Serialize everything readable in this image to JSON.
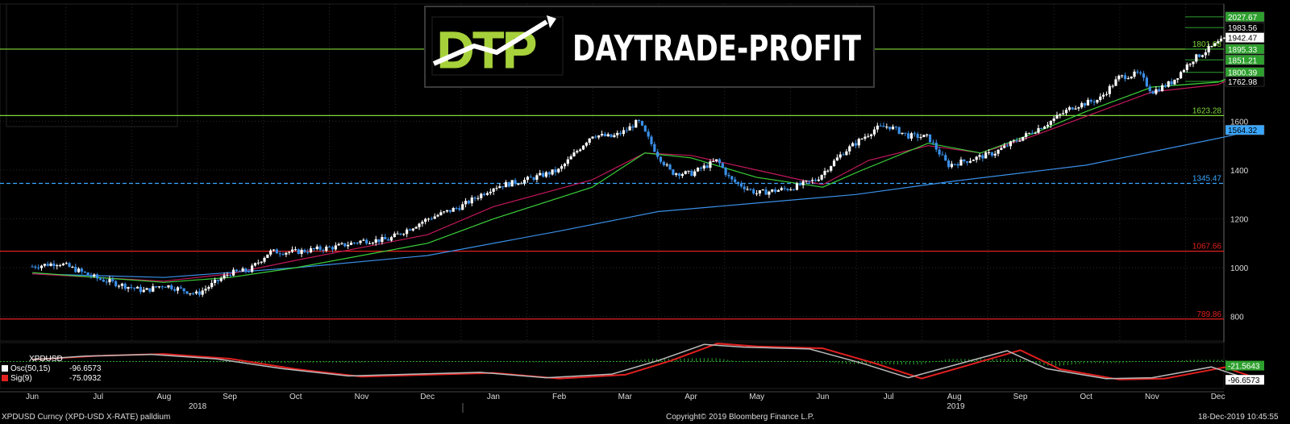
{
  "logo": {
    "mark": "DTP",
    "text": "DAYTRADE-PROFIT"
  },
  "chart_data": {
    "type": "candlestick",
    "y_ticks": [
      "1600",
      "1400",
      "1200",
      "1000",
      "800"
    ],
    "ylim": [
      700,
      2080
    ],
    "x_months": [
      "Jun",
      "Jul",
      "Aug",
      "Sep",
      "Oct",
      "Nov",
      "Dec",
      "Jan",
      "Feb",
      "Mar",
      "Apr",
      "May",
      "Jun",
      "Jul",
      "Aug",
      "Sep",
      "Oct",
      "Nov",
      "Dec"
    ],
    "x_years": [
      "2018",
      "2019"
    ],
    "price_path": [
      {
        "m": 0.0,
        "v": 1005
      },
      {
        "m": 0.4,
        "v": 1020
      },
      {
        "m": 1.0,
        "v": 955
      },
      {
        "m": 1.7,
        "v": 905
      },
      {
        "m": 2.0,
        "v": 930
      },
      {
        "m": 2.5,
        "v": 892
      },
      {
        "m": 3.0,
        "v": 978
      },
      {
        "m": 3.3,
        "v": 990
      },
      {
        "m": 3.6,
        "v": 1065
      },
      {
        "m": 4.0,
        "v": 1065
      },
      {
        "m": 4.6,
        "v": 1085
      },
      {
        "m": 5.0,
        "v": 1110
      },
      {
        "m": 5.4,
        "v": 1115
      },
      {
        "m": 6.0,
        "v": 1200
      },
      {
        "m": 6.5,
        "v": 1250
      },
      {
        "m": 7.0,
        "v": 1330
      },
      {
        "m": 7.5,
        "v": 1360
      },
      {
        "m": 8.0,
        "v": 1400
      },
      {
        "m": 8.5,
        "v": 1545
      },
      {
        "m": 8.8,
        "v": 1535
      },
      {
        "m": 9.0,
        "v": 1560
      },
      {
        "m": 9.2,
        "v": 1600
      },
      {
        "m": 9.5,
        "v": 1460
      },
      {
        "m": 9.7,
        "v": 1390
      },
      {
        "m": 10.0,
        "v": 1385
      },
      {
        "m": 10.4,
        "v": 1440
      },
      {
        "m": 10.6,
        "v": 1360
      },
      {
        "m": 11.0,
        "v": 1305
      },
      {
        "m": 11.5,
        "v": 1325
      },
      {
        "m": 11.9,
        "v": 1360
      },
      {
        "m": 12.3,
        "v": 1470
      },
      {
        "m": 12.8,
        "v": 1570
      },
      {
        "m": 13.0,
        "v": 1580
      },
      {
        "m": 13.3,
        "v": 1540
      },
      {
        "m": 13.6,
        "v": 1535
      },
      {
        "m": 13.9,
        "v": 1420
      },
      {
        "m": 14.2,
        "v": 1440
      },
      {
        "m": 14.6,
        "v": 1470
      },
      {
        "m": 15.0,
        "v": 1530
      },
      {
        "m": 15.4,
        "v": 1590
      },
      {
        "m": 15.8,
        "v": 1660
      },
      {
        "m": 16.2,
        "v": 1690
      },
      {
        "m": 16.5,
        "v": 1780
      },
      {
        "m": 16.8,
        "v": 1795
      },
      {
        "m": 17.0,
        "v": 1720
      },
      {
        "m": 17.3,
        "v": 1760
      },
      {
        "m": 17.6,
        "v": 1850
      },
      {
        "m": 18.0,
        "v": 1920
      },
      {
        "m": 18.3,
        "v": 1965
      }
    ],
    "ma_slow": [
      {
        "m": 0,
        "v": 975
      },
      {
        "m": 2,
        "v": 960
      },
      {
        "m": 4,
        "v": 1000
      },
      {
        "m": 6,
        "v": 1050
      },
      {
        "m": 8,
        "v": 1150
      },
      {
        "m": 9.5,
        "v": 1230
      },
      {
        "m": 11,
        "v": 1265
      },
      {
        "m": 12.5,
        "v": 1300
      },
      {
        "m": 14,
        "v": 1355
      },
      {
        "m": 16,
        "v": 1420
      },
      {
        "m": 18,
        "v": 1530
      },
      {
        "m": 18.6,
        "v": 1564
      }
    ],
    "ma_mid": [
      {
        "m": 0,
        "v": 975
      },
      {
        "m": 2,
        "v": 945
      },
      {
        "m": 3,
        "v": 975
      },
      {
        "m": 4,
        "v": 1030
      },
      {
        "m": 6,
        "v": 1135
      },
      {
        "m": 7,
        "v": 1250
      },
      {
        "m": 8.5,
        "v": 1360
      },
      {
        "m": 9.3,
        "v": 1470
      },
      {
        "m": 10,
        "v": 1460
      },
      {
        "m": 11,
        "v": 1400
      },
      {
        "m": 12,
        "v": 1340
      },
      {
        "m": 12.7,
        "v": 1440
      },
      {
        "m": 13.6,
        "v": 1500
      },
      {
        "m": 14.4,
        "v": 1470
      },
      {
        "m": 15.2,
        "v": 1540
      },
      {
        "m": 16,
        "v": 1620
      },
      {
        "m": 17,
        "v": 1720
      },
      {
        "m": 18,
        "v": 1750
      },
      {
        "m": 18.4,
        "v": 1800
      }
    ],
    "ma_fast": [
      {
        "m": 0,
        "v": 980
      },
      {
        "m": 2,
        "v": 940
      },
      {
        "m": 3,
        "v": 960
      },
      {
        "m": 4,
        "v": 1000
      },
      {
        "m": 6,
        "v": 1100
      },
      {
        "m": 7,
        "v": 1200
      },
      {
        "m": 8.5,
        "v": 1330
      },
      {
        "m": 9.3,
        "v": 1470
      },
      {
        "m": 10,
        "v": 1450
      },
      {
        "m": 11,
        "v": 1370
      },
      {
        "m": 12,
        "v": 1330
      },
      {
        "m": 12.6,
        "v": 1400
      },
      {
        "m": 13.6,
        "v": 1510
      },
      {
        "m": 14.4,
        "v": 1470
      },
      {
        "m": 15.2,
        "v": 1550
      },
      {
        "m": 16,
        "v": 1640
      },
      {
        "m": 17,
        "v": 1740
      },
      {
        "m": 18,
        "v": 1760
      },
      {
        "m": 18.4,
        "v": 1800
      }
    ],
    "levels": [
      {
        "value": 1895.33,
        "label": "1801.08",
        "color": "#7fd93a",
        "style": "solid"
      },
      {
        "value": 1623.28,
        "label": "1623.28",
        "color": "#7fd93a",
        "style": "solid"
      },
      {
        "value": 1345.47,
        "label": "1345.47",
        "color": "#3aa7ff",
        "style": "dashed"
      },
      {
        "value": 1067.66,
        "label": "1067.66",
        "color": "#e22020",
        "style": "solid"
      },
      {
        "value": 789.86,
        "label": "789.86",
        "color": "#e22020",
        "style": "solid"
      }
    ],
    "right_labels": [
      {
        "value": 2027.67,
        "text": "2027.67",
        "bg": "#2ea02e",
        "fg": "#fff"
      },
      {
        "value": 1983.56,
        "text": "1983.56",
        "bg": "#000",
        "fg": "#fff"
      },
      {
        "value": 1942.47,
        "text": "1942.47",
        "bg": "#fff",
        "fg": "#000"
      },
      {
        "value": 1895.33,
        "text": "1895.33",
        "bg": "#2ea02e",
        "fg": "#fff"
      },
      {
        "value": 1851.21,
        "text": "1851.21",
        "bg": "#2ea02e",
        "fg": "#fff"
      },
      {
        "value": 1800.39,
        "text": "1800.39",
        "bg": "#2ea02e",
        "fg": "#fff"
      },
      {
        "value": 1762.98,
        "text": "1762.98",
        "bg": "#000",
        "fg": "#fff"
      },
      {
        "value": 1564.32,
        "text": "1564.32",
        "bg": "#3aa7ff",
        "fg": "#000"
      }
    ],
    "oscillator": {
      "title": "XPDUSD",
      "osc_label": "Osc(50,15)",
      "osc_value": "-96.6573",
      "sig_label": "Sig(9)",
      "sig_value": "-75.0932",
      "right_top": "-21.5643",
      "right_bottom": "-96.6573",
      "path": [
        {
          "m": 0,
          "v": 10
        },
        {
          "m": 1,
          "v": 30
        },
        {
          "m": 2,
          "v": 40
        },
        {
          "m": 3,
          "v": 15
        },
        {
          "m": 4,
          "v": -40
        },
        {
          "m": 5,
          "v": -80
        },
        {
          "m": 6,
          "v": -70
        },
        {
          "m": 7,
          "v": -60
        },
        {
          "m": 8,
          "v": -90
        },
        {
          "m": 9,
          "v": -70
        },
        {
          "m": 9.7,
          "v": 5
        },
        {
          "m": 10.4,
          "v": 95
        },
        {
          "m": 11,
          "v": 80
        },
        {
          "m": 12,
          "v": 70
        },
        {
          "m": 12.8,
          "v": -10
        },
        {
          "m": 13.5,
          "v": -90
        },
        {
          "m": 14,
          "v": -40
        },
        {
          "m": 15,
          "v": 60
        },
        {
          "m": 15.6,
          "v": -40
        },
        {
          "m": 16.5,
          "v": -95
        },
        {
          "m": 17.2,
          "v": -90
        },
        {
          "m": 17.8,
          "v": -50
        },
        {
          "m": 18.1,
          "v": -30
        },
        {
          "m": 18.6,
          "v": -90
        }
      ]
    }
  },
  "footer": {
    "left": "XPDUSD Curncy (XPD-USD X-RATE) palldium",
    "center": "Copyright© 2019 Bloomberg Finance L.P.",
    "right": "18-Dec-2019 10:45:55"
  }
}
